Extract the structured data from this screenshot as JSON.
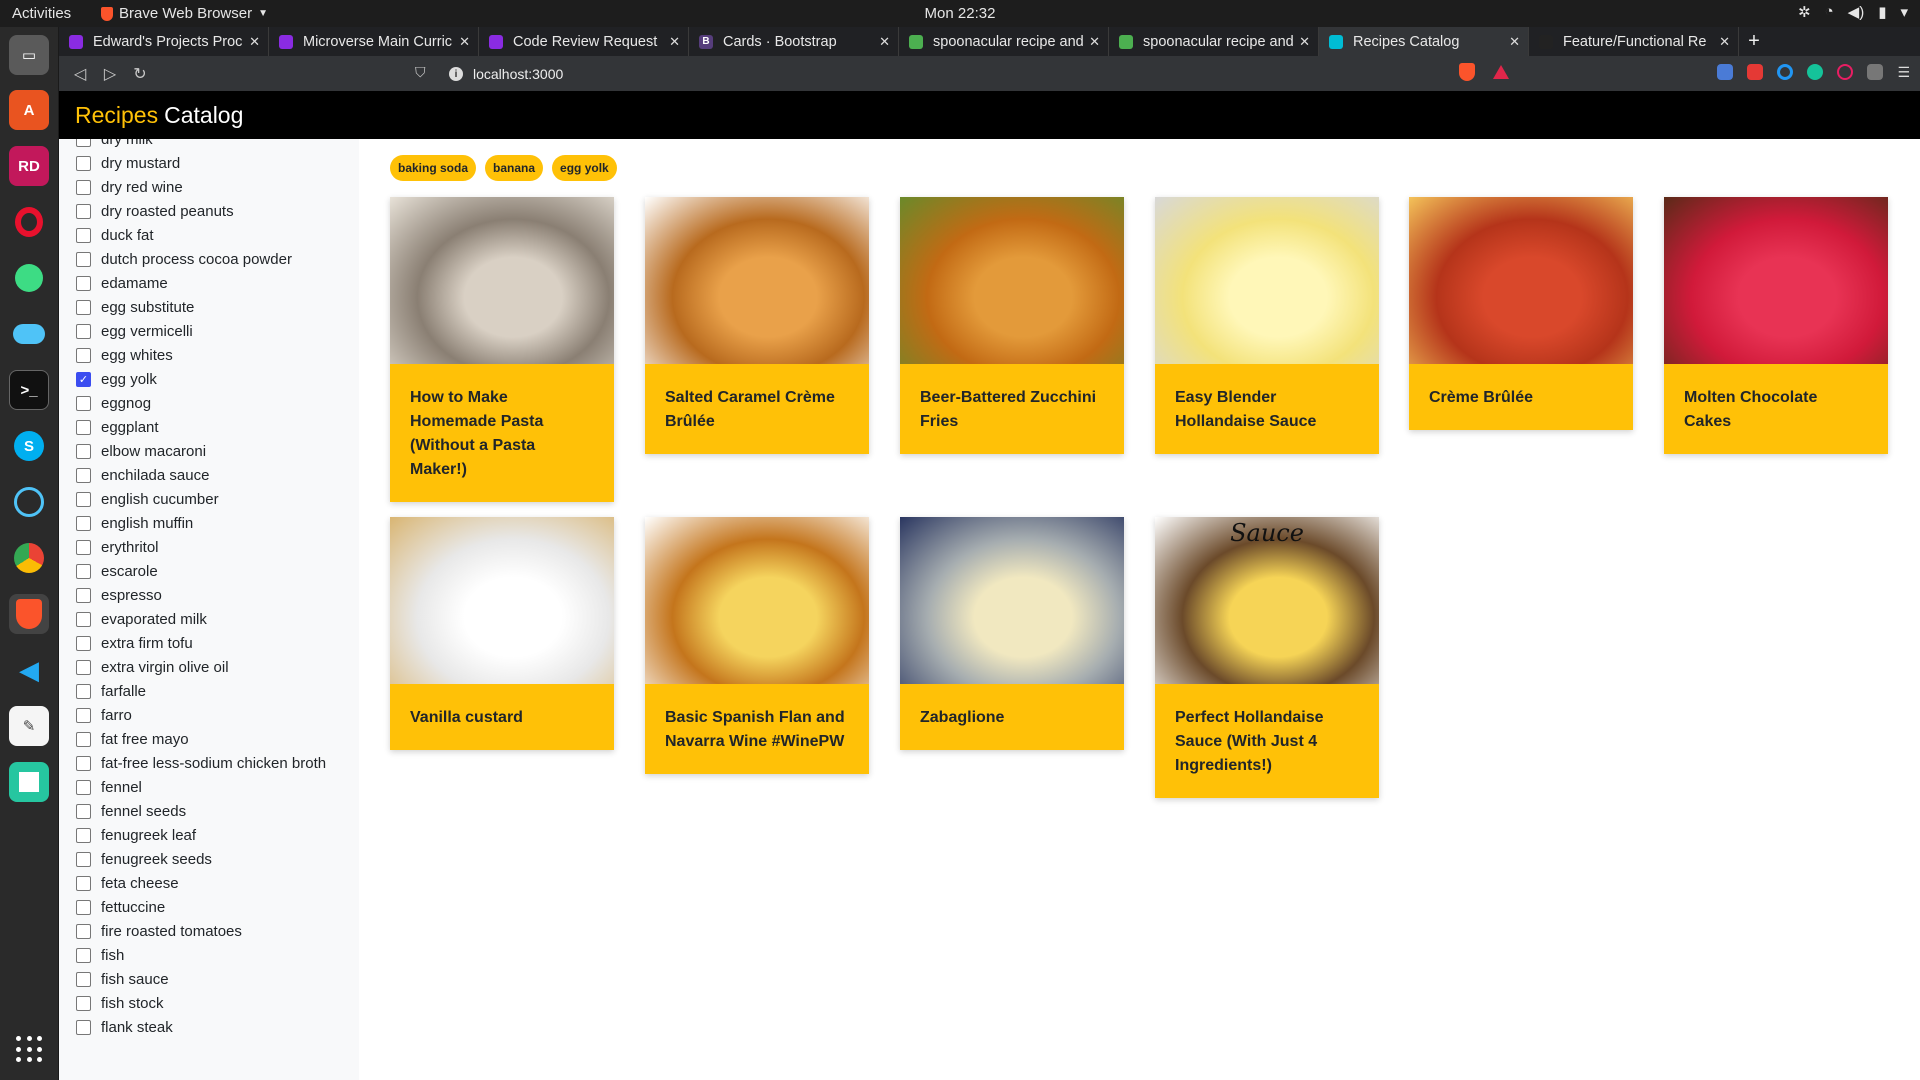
{
  "os": {
    "activities": "Activities",
    "app_name": "Brave Web Browser",
    "clock": "Mon 22:32"
  },
  "tabs": [
    {
      "title": "Edward's Projects Proc",
      "favicon_color": "#8a2be2",
      "active": false
    },
    {
      "title": "Microverse Main Curric",
      "favicon_color": "#8a2be2",
      "active": false
    },
    {
      "title": "Code Review Request",
      "favicon_color": "#8a2be2",
      "active": false
    },
    {
      "title": "Cards · Bootstrap",
      "favicon_color": "#563d7c",
      "favicon_text": "B",
      "active": false
    },
    {
      "title": "spoonacular recipe and",
      "favicon_color": "#4caf50",
      "active": false
    },
    {
      "title": "spoonacular recipe and",
      "favicon_color": "#4caf50",
      "active": false
    },
    {
      "title": "Recipes Catalog",
      "favicon_color": "#00bcd4",
      "active": true
    },
    {
      "title": "Feature/Functional Re",
      "favicon_color": "#222222",
      "active": false
    }
  ],
  "address": {
    "url": "localhost:3000"
  },
  "app": {
    "brand_part1": "Recipes",
    "brand_part2": "Catalog",
    "accent_color": "#ffc107"
  },
  "ingredients": [
    {
      "label": "dry milk",
      "checked": false
    },
    {
      "label": "dry mustard",
      "checked": false
    },
    {
      "label": "dry red wine",
      "checked": false
    },
    {
      "label": "dry roasted peanuts",
      "checked": false
    },
    {
      "label": "duck fat",
      "checked": false
    },
    {
      "label": "dutch process cocoa powder",
      "checked": false
    },
    {
      "label": "edamame",
      "checked": false
    },
    {
      "label": "egg substitute",
      "checked": false
    },
    {
      "label": "egg vermicelli",
      "checked": false
    },
    {
      "label": "egg whites",
      "checked": false
    },
    {
      "label": "egg yolk",
      "checked": true
    },
    {
      "label": "eggnog",
      "checked": false
    },
    {
      "label": "eggplant",
      "checked": false
    },
    {
      "label": "elbow macaroni",
      "checked": false
    },
    {
      "label": "enchilada sauce",
      "checked": false
    },
    {
      "label": "english cucumber",
      "checked": false
    },
    {
      "label": "english muffin",
      "checked": false
    },
    {
      "label": "erythritol",
      "checked": false
    },
    {
      "label": "escarole",
      "checked": false
    },
    {
      "label": "espresso",
      "checked": false
    },
    {
      "label": "evaporated milk",
      "checked": false
    },
    {
      "label": "extra firm tofu",
      "checked": false
    },
    {
      "label": "extra virgin olive oil",
      "checked": false
    },
    {
      "label": "farfalle",
      "checked": false
    },
    {
      "label": "farro",
      "checked": false
    },
    {
      "label": "fat free mayo",
      "checked": false
    },
    {
      "label": "fat-free less-sodium chicken broth",
      "checked": false
    },
    {
      "label": "fennel",
      "checked": false
    },
    {
      "label": "fennel seeds",
      "checked": false
    },
    {
      "label": "fenugreek leaf",
      "checked": false
    },
    {
      "label": "fenugreek seeds",
      "checked": false
    },
    {
      "label": "feta cheese",
      "checked": false
    },
    {
      "label": "fettuccine",
      "checked": false
    },
    {
      "label": "fire roasted tomatoes",
      "checked": false
    },
    {
      "label": "fish",
      "checked": false
    },
    {
      "label": "fish sauce",
      "checked": false
    },
    {
      "label": "fish stock",
      "checked": false
    },
    {
      "label": "flank steak",
      "checked": false
    }
  ],
  "selected_chips": [
    "baking soda",
    "banana",
    "egg yolk"
  ],
  "recipes": [
    {
      "title": "How to Make Homemade Pasta (Without a Pasta Maker!)",
      "photo": "hands-rolling-dough",
      "colors": [
        "#8a7f73",
        "#d9d0c4",
        "#e8e2d8"
      ]
    },
    {
      "title": "Salted Caramel Crème Brûlée",
      "photo": "creme-brulee-ramekin",
      "colors": [
        "#b86a1e",
        "#e9a14a",
        "#ffffff"
      ]
    },
    {
      "title": "Beer-Battered Zucchini Fries",
      "photo": "zucchini-fries",
      "colors": [
        "#c26a14",
        "#e39a3a",
        "#6a8a2a"
      ]
    },
    {
      "title": "Easy Blender Hollandaise Sauce",
      "photo": "hollandaise-spoon",
      "colors": [
        "#f3e27a",
        "#fff7b8",
        "#d8d8d8"
      ]
    },
    {
      "title": "Crème Brûlée",
      "photo": "creme-brulee-raspberries",
      "colors": [
        "#b5341a",
        "#d9482b",
        "#f4c35a"
      ]
    },
    {
      "title": "Molten Chocolate Cakes",
      "photo": "magazine-cover-chocolate",
      "colors": [
        "#d11a3a",
        "#e83354",
        "#5a2a18"
      ]
    },
    {
      "title": "Vanilla custard",
      "photo": "custard-pitcher",
      "colors": [
        "#e8e8e8",
        "#ffffff",
        "#d9b572"
      ]
    },
    {
      "title": "Basic Spanish Flan and Navarra Wine #WinePW",
      "photo": "flan-plate",
      "colors": [
        "#c4751c",
        "#f5d45e",
        "#ffffff"
      ]
    },
    {
      "title": "Zabaglione",
      "photo": "zabaglione-blueberries",
      "colors": [
        "#a6adb0",
        "#f1e8c0",
        "#2a3660"
      ]
    },
    {
      "title": "Perfect Hollandaise Sauce (With Just 4 Ingredients!)",
      "photo": "hollandaise-ramekin",
      "colors": [
        "#6b4a2a",
        "#f6d456",
        "#ffffff"
      ],
      "overlay_text": "Sauce"
    }
  ]
}
